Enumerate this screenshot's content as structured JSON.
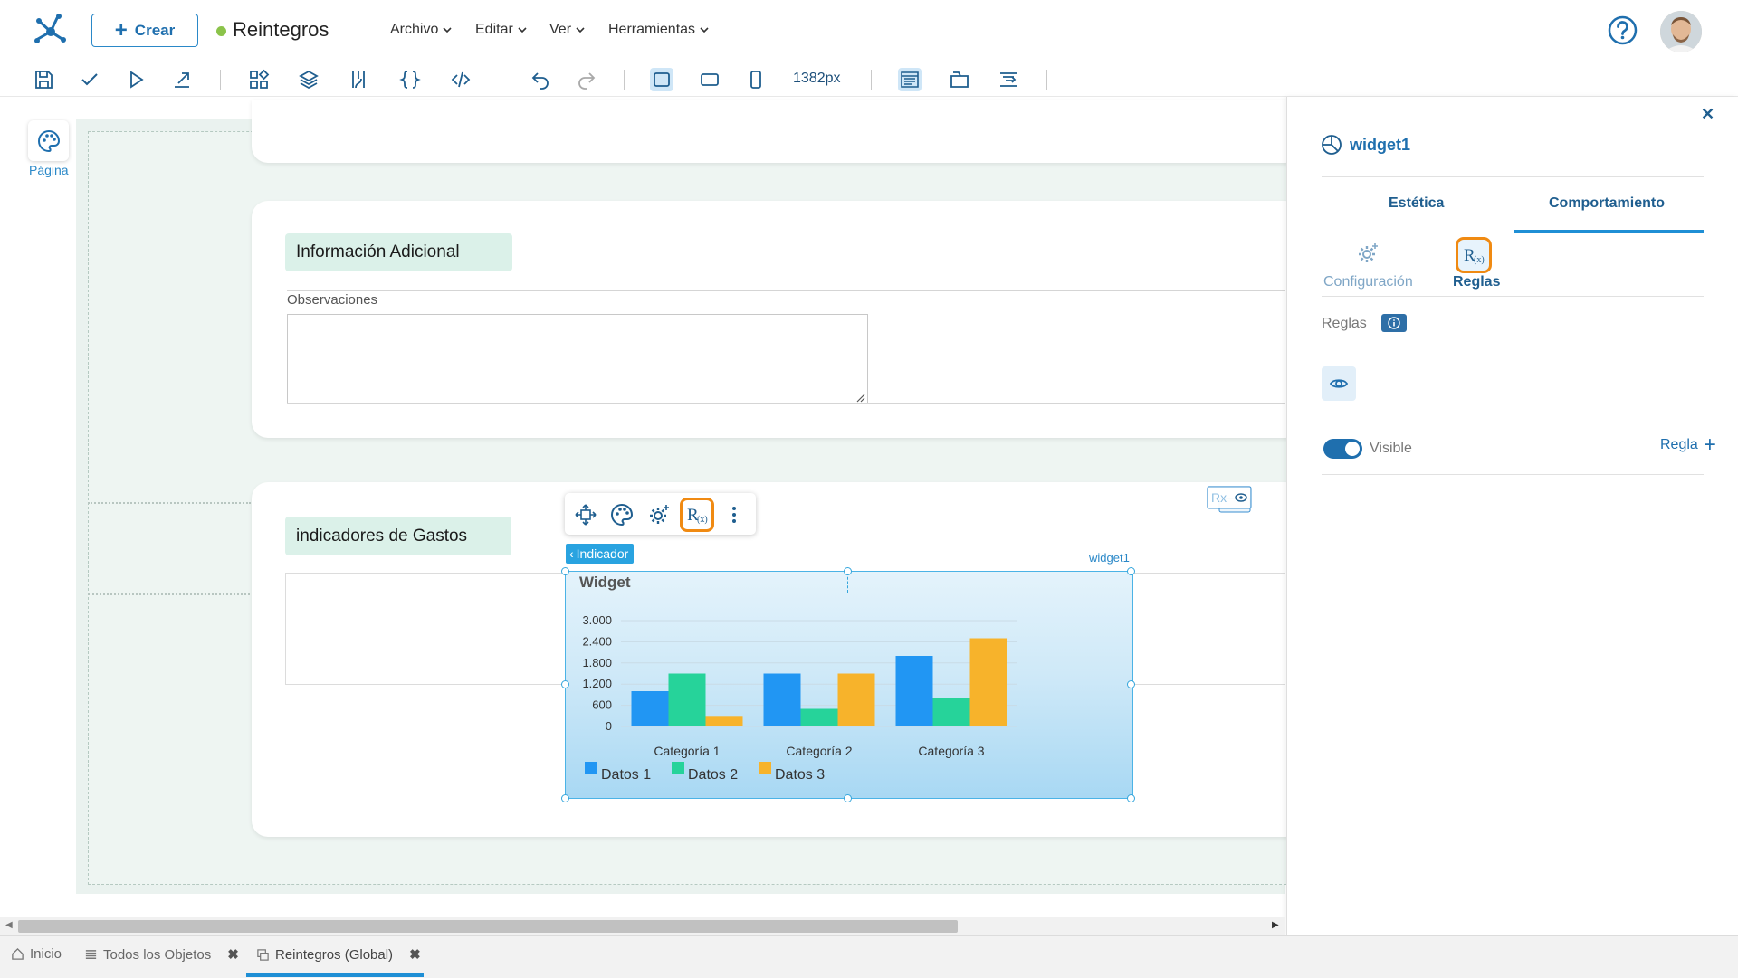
{
  "app": {
    "create_label": "Crear",
    "doc_title": "Reintegros",
    "status_color": "#8bc34a",
    "menus": [
      "Archivo",
      "Editar",
      "Ver",
      "Herramientas"
    ]
  },
  "toolbar": {
    "width_value": "1382px",
    "icons": [
      "save-icon",
      "check-icon",
      "play-icon",
      "publish-icon",
      "components-icon",
      "layers-icon",
      "data-icon",
      "braces-icon",
      "code-icon",
      "undo-icon",
      "redo-icon",
      "desktop-icon",
      "tablet-icon",
      "mobile-icon",
      "layout-icon",
      "container-icon",
      "align-icon"
    ]
  },
  "canvas": {
    "page_label": "Página",
    "section1_title": "Información Adicional",
    "observations_label": "Observaciones",
    "section2_title": "indicadores de Gastos",
    "indicator_tag": "Indicador",
    "widget_id": "widget1",
    "rx_badge": "Rx"
  },
  "chart_data": {
    "type": "bar",
    "title": "Widget",
    "categories": [
      "Categoría 1",
      "Categoría 2",
      "Categoría 3"
    ],
    "series": [
      {
        "name": "Datos 1",
        "values": [
          1000,
          1500,
          2000
        ],
        "color": "#2196f3"
      },
      {
        "name": "Datos 2",
        "values": [
          1500,
          500,
          800
        ],
        "color": "#26d39a"
      },
      {
        "name": "Datos 3",
        "values": [
          300,
          1500,
          2500
        ],
        "color": "#f7b32b"
      }
    ],
    "yticks": [
      "0",
      "600",
      "1.200",
      "1.800",
      "2.400",
      "3.000"
    ],
    "ylim": [
      0,
      3000
    ],
    "legend_position": "bottom-left",
    "grid": true
  },
  "panel": {
    "widget_name": "widget1",
    "tabs": [
      "Estética",
      "Comportamiento"
    ],
    "active_tab": "Comportamiento",
    "subtabs": [
      "Configuración",
      "Reglas"
    ],
    "active_subtab": "Reglas",
    "rules_label": "Reglas",
    "toggle_label": "Visible",
    "toggle_on": true,
    "add_rule_label": "Regla"
  },
  "bottom_tabs": [
    {
      "label": "Inicio",
      "icon": "home-icon",
      "closable": false
    },
    {
      "label": "Todos los Objetos",
      "icon": "list-icon",
      "closable": true
    },
    {
      "label": "Reintegros (Global)",
      "icon": "form-icon",
      "closable": true,
      "active": true
    }
  ]
}
